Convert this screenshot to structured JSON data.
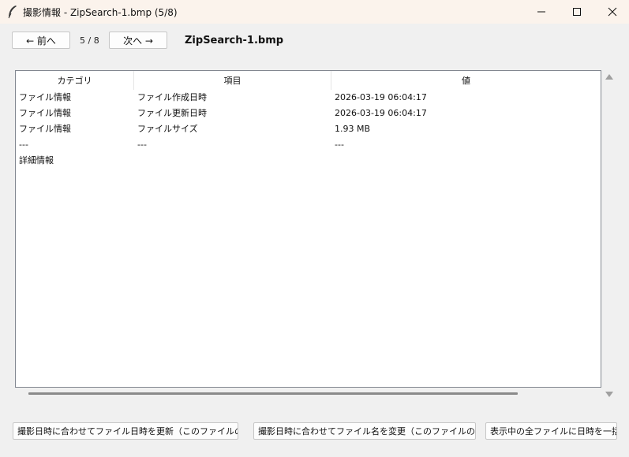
{
  "window": {
    "title": "撮影情報 - ZipSearch-1.bmp (5/8)",
    "icon": "feather-pen-icon"
  },
  "nav": {
    "prev_label": "← 前へ",
    "counter": "5 / 8",
    "next_label": "次へ →",
    "filename": "ZipSearch-1.bmp"
  },
  "table": {
    "headers": [
      "カテゴリ",
      "項目",
      "値"
    ],
    "rows": [
      [
        "ファイル情報",
        "ファイル作成日時",
        "2026-03-19 06:04:17"
      ],
      [
        "ファイル情報",
        "ファイル更新日時",
        "2026-03-19 06:04:17"
      ],
      [
        "ファイル情報",
        "ファイルサイズ",
        "1.93 MB"
      ],
      [
        "---",
        "---",
        "---"
      ],
      [
        "詳細情報",
        "",
        ""
      ]
    ]
  },
  "actions": {
    "update_file_date": "撮影日時に合わせてファイル日時を更新（このファイルのみ）",
    "rename_file": "撮影日時に合わせてファイル名を変更（このファイルのみ）",
    "batch_all": "表示中の全ファイルに日時を一括"
  }
}
